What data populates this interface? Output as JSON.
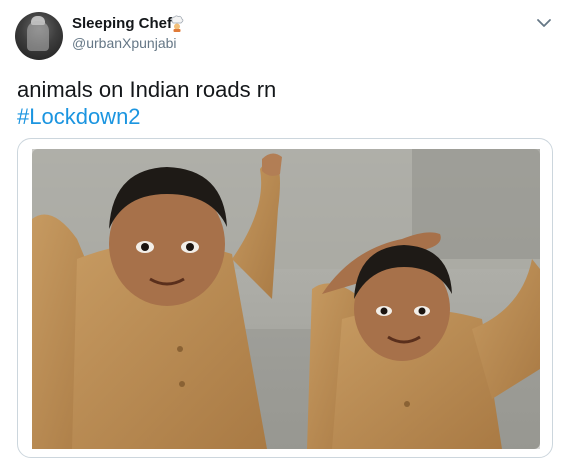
{
  "author": {
    "display_name": "Sleeping Chef",
    "handle": "@urbanXpunjabi",
    "badge_icon": "chef-icon",
    "avatar_icon": "avatar"
  },
  "tweet": {
    "text": "animals on Indian roads rn",
    "hashtag": "#Lockdown2"
  },
  "menu": {
    "icon": "chevron-down-icon"
  },
  "media": {
    "description_icon": "meme-photo"
  },
  "colors": {
    "text": "#14171a",
    "secondary": "#657786",
    "link": "#1b95e0",
    "border": "#ccd6dd"
  }
}
